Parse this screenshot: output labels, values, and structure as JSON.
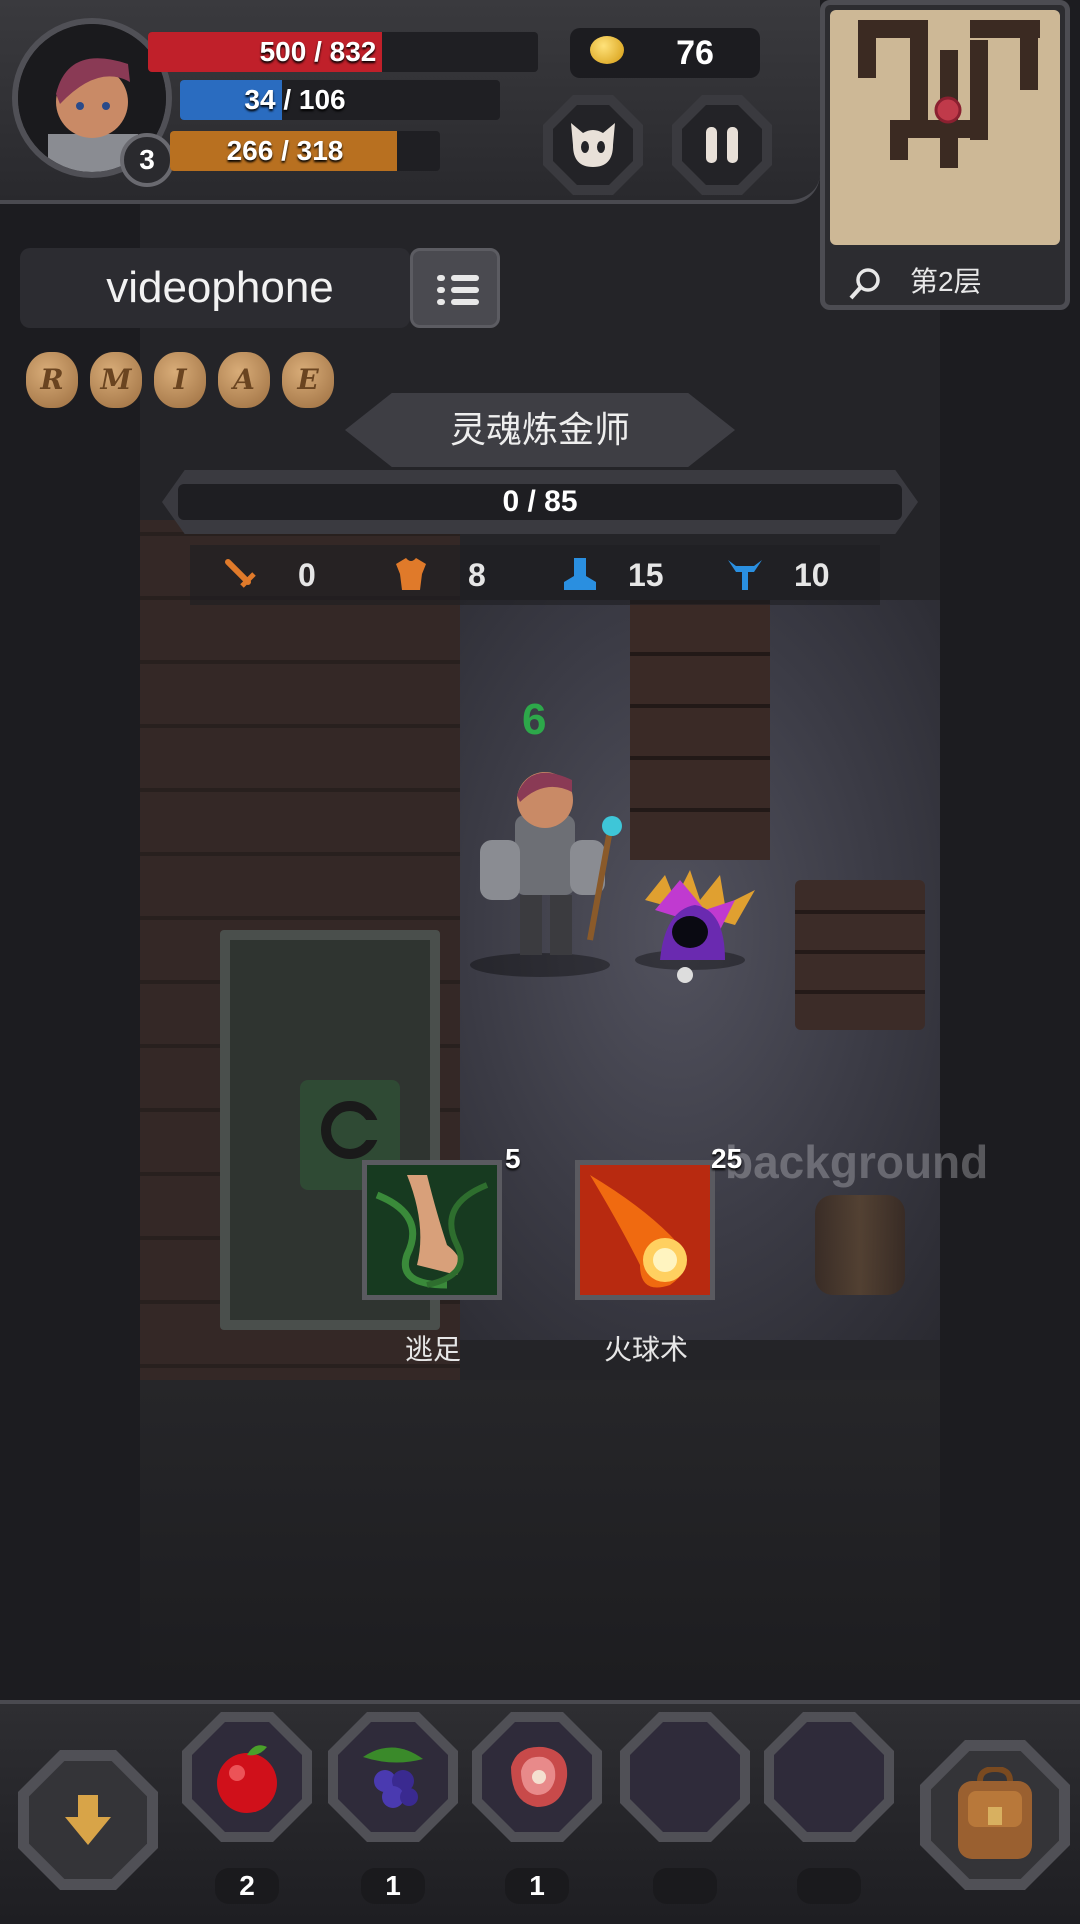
{
  "player": {
    "level": "3",
    "hp": "500 / 832",
    "hp_fraction": 0.6,
    "mp": "34 / 106",
    "mp_fraction": 0.32,
    "xp": "266 / 318",
    "xp_fraction": 0.84,
    "name": "videophone",
    "runes": [
      "R",
      "M",
      "I",
      "A",
      "E"
    ]
  },
  "gold": "76",
  "minimap": {
    "floor_label": "第2层"
  },
  "enemy": {
    "name": "灵魂炼金师",
    "hp": "0 / 85",
    "stats": [
      {
        "icon": "sword-icon",
        "value": "0",
        "color": "#e07a2a"
      },
      {
        "icon": "armor-icon",
        "value": "8",
        "color": "#e07a2a"
      },
      {
        "icon": "boot-icon",
        "value": "15",
        "color": "#2a8fe0"
      },
      {
        "icon": "horns-icon",
        "value": "10",
        "color": "#2a8fe0"
      }
    ]
  },
  "damage_number": "6",
  "skills": [
    {
      "name": "逃足",
      "count": "5"
    },
    {
      "name": "火球术",
      "count": "25"
    }
  ],
  "background_label": "background",
  "inventory": [
    {
      "item": "apple-icon",
      "count": "2"
    },
    {
      "item": "berries-icon",
      "count": "1"
    },
    {
      "item": "meat-icon",
      "count": "1"
    },
    {
      "item": "empty",
      "count": ""
    },
    {
      "item": "empty",
      "count": ""
    }
  ],
  "colors": {
    "hp": "#c0202a",
    "mp": "#2a6cc0",
    "xp": "#b87020",
    "damage": "#2da84a"
  }
}
